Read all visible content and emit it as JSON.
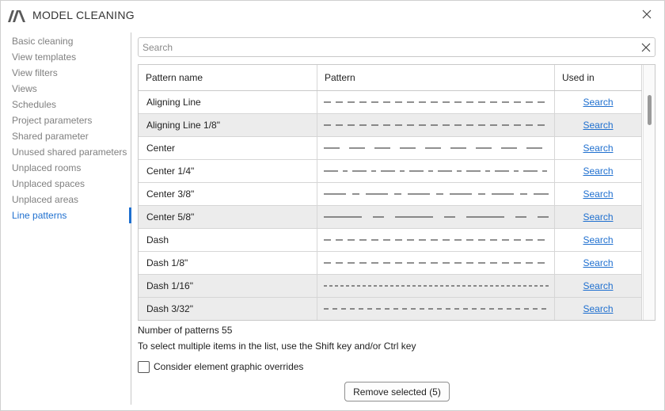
{
  "window": {
    "title": "MODEL CLEANING",
    "logo_icon": "logo-icon",
    "close_icon": "close-icon"
  },
  "sidebar": {
    "items": [
      {
        "label": "Basic cleaning",
        "active": false
      },
      {
        "label": "View templates",
        "active": false
      },
      {
        "label": "View filters",
        "active": false
      },
      {
        "label": "Views",
        "active": false
      },
      {
        "label": "Schedules",
        "active": false
      },
      {
        "label": "Project parameters",
        "active": false
      },
      {
        "label": "Shared parameter",
        "active": false
      },
      {
        "label": "Unused shared parameters",
        "active": false
      },
      {
        "label": "Unplaced rooms",
        "active": false
      },
      {
        "label": "Unplaced spaces",
        "active": false
      },
      {
        "label": "Unplaced areas",
        "active": false
      },
      {
        "label": "Line patterns",
        "active": true
      }
    ],
    "active_color": "#1e6fcf"
  },
  "search": {
    "placeholder": "Search",
    "value": "",
    "clear_icon": "close-icon"
  },
  "table": {
    "columns": [
      "Pattern name",
      "Pattern",
      "Used in"
    ],
    "rows": [
      {
        "name": "Aligning Line",
        "pattern": "aligning",
        "used_in": "Search",
        "highlighted": false
      },
      {
        "name": "Aligning Line 1/8\"",
        "pattern": "aligning",
        "used_in": "Search",
        "highlighted": true
      },
      {
        "name": "Center",
        "pattern": "center",
        "used_in": "Search",
        "highlighted": false
      },
      {
        "name": "Center 1/4\"",
        "pattern": "center-quarter",
        "used_in": "Search",
        "highlighted": false
      },
      {
        "name": "Center 3/8\"",
        "pattern": "center-three-eighths",
        "used_in": "Search",
        "highlighted": false
      },
      {
        "name": "Center 5/8\"",
        "pattern": "center-five-eighths",
        "used_in": "Search",
        "highlighted": true
      },
      {
        "name": "Dash",
        "pattern": "dash",
        "used_in": "Search",
        "highlighted": false
      },
      {
        "name": "Dash 1/8\"",
        "pattern": "dash",
        "used_in": "Search",
        "highlighted": false
      },
      {
        "name": "Dash 1/16\"",
        "pattern": "dash-fine",
        "used_in": "Search",
        "highlighted": true
      },
      {
        "name": "Dash 3/32\"",
        "pattern": "dash-small",
        "used_in": "Search",
        "highlighted": true
      }
    ],
    "link_color": "#1e6fcf",
    "highlight_color": "#ececec"
  },
  "footer": {
    "count_text": "Number of patterns 55",
    "hint_text": "To select multiple items in the list, use the Shift key and/or Ctrl key",
    "checkbox_label": "Consider element graphic overrides",
    "checkbox_checked": false,
    "remove_button_label": "Remove selected (5)"
  }
}
